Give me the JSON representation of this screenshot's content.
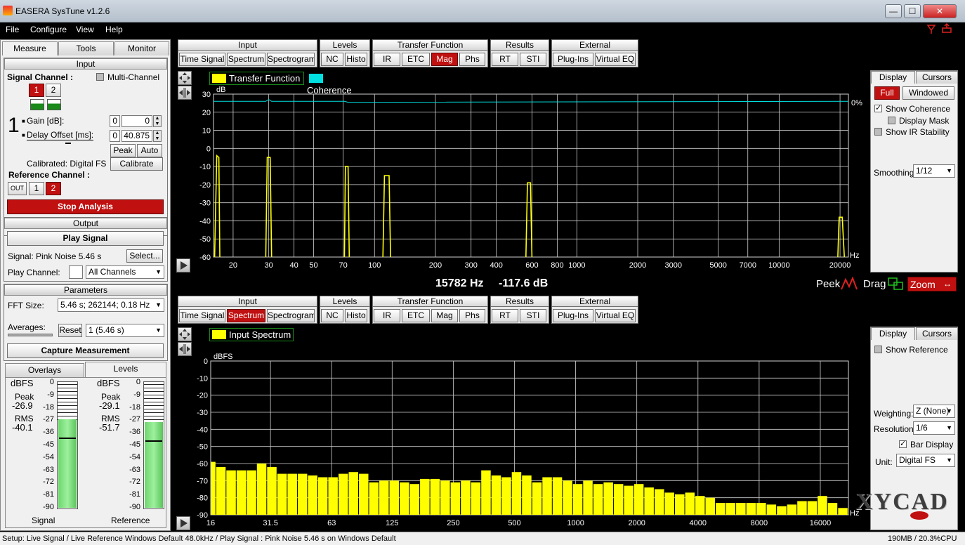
{
  "title_bar": {
    "title": "EASERA SysTune v1.2.6",
    "min": "—",
    "max": "☐",
    "close": "✕"
  },
  "menu": [
    "File",
    "Configure",
    "View",
    "Help"
  ],
  "left_tabs": [
    "Measure",
    "Tools",
    "Monitor"
  ],
  "input_section": {
    "header": "Input",
    "signal_channel": "Signal Channel :",
    "multi_channel": "Multi-Channel",
    "channel_buttons": [
      "1",
      "2"
    ],
    "channel_number": "1",
    "gain_label": "Gain [dB]:",
    "gain_box": "0",
    "gain_value": "0",
    "delay_label": "Delay Offset [ms]:",
    "delay_box": "0",
    "delay_value": "40.875",
    "peak": "Peak",
    "auto": "Auto",
    "calibrated": "Calibrated: Digital FS",
    "calibrate": "Calibrate",
    "reference_channel": "Reference Channel :",
    "ref_buttons": [
      "OUT",
      "1",
      "2"
    ]
  },
  "stop_analysis": "Stop Analysis",
  "output_section": {
    "header": "Output",
    "play_signal": "Play Signal",
    "signal": "Signal: Pink Noise  5.46 s",
    "select": "Select...",
    "play_channel": "Play Channel:",
    "play_channel_value": "All Channels"
  },
  "parameters_section": {
    "header": "Parameters",
    "fft_size": "FFT Size:",
    "fft_value": "5.46 s; 262144; 0.18 Hz",
    "averages": "Averages:",
    "reset": "Reset",
    "avg_value": "1 (5.46 s)",
    "capture": "Capture Measurement"
  },
  "bottom_tabs": [
    "Overlays",
    "Levels"
  ],
  "meters": {
    "unit": "dBFS",
    "scale": [
      "0",
      "-9",
      "-18",
      "-27",
      "-36",
      "-45",
      "-54",
      "-63",
      "-72",
      "-81",
      "-90"
    ],
    "signal": {
      "peak_label": "Peak",
      "peak": "-26.9",
      "rms_label": "RMS",
      "rms": "-40.1",
      "name": "Signal",
      "level_fraction": 0.7
    },
    "reference": {
      "peak_label": "Peak",
      "peak": "-29.1",
      "rms_label": "RMS",
      "rms": "-51.7",
      "name": "Reference",
      "level_fraction": 0.68
    }
  },
  "toolbar_top": {
    "groups": [
      {
        "name": "Input",
        "buttons": [
          "Time Signal",
          "Spectrum",
          "Spectrogram"
        ]
      },
      {
        "name": "Levels",
        "buttons": [
          "NC",
          "Histo"
        ]
      },
      {
        "name": "Transfer Function",
        "buttons": [
          "IR",
          "ETC",
          "Mag",
          "Phs"
        ]
      },
      {
        "name": "Results",
        "buttons": [
          "RT",
          "STI"
        ]
      },
      {
        "name": "External",
        "buttons": [
          "Plug-Ins",
          "Virtual EQ"
        ]
      }
    ],
    "active": "Mag"
  },
  "toolbar_bottom": {
    "active": "Spectrum"
  },
  "top_chart": {
    "legend": [
      "Transfer Function",
      "Coherence"
    ],
    "ylabel": "dB",
    "xunit": "Hz",
    "coherence_label": "0%",
    "readout_freq": "15782 Hz",
    "readout_db": "-117.6 dB",
    "peek": "Peek",
    "drag": "Drag",
    "zoom": "Zoom"
  },
  "top_right_panel": {
    "tabs": [
      "Display",
      "Cursors"
    ],
    "full": "Full",
    "windowed": "Windowed",
    "show_coherence": "Show Coherence",
    "display_mask": "Display Mask",
    "show_ir": "Show IR Stability",
    "smoothing_label": "Smoothing:",
    "smoothing": "1/12"
  },
  "bottom_chart": {
    "legend": "Input Spectrum",
    "ylabel": "dBFS",
    "xunit": "Hz"
  },
  "bottom_right_panel": {
    "tabs": [
      "Display",
      "Cursors"
    ],
    "show_reference": "Show Reference",
    "weighting_label": "Weighting:",
    "weighting": "Z (None)",
    "resolution_label": "Resolution:",
    "resolution": "1/6",
    "bar_display": "Bar Display",
    "unit_label": "Unit:",
    "unit": "Digital FS"
  },
  "watermark": "XYCAD",
  "status_bar": {
    "left": "Setup: Live Signal / Live Reference Windows Default 48.0kHz / Play Signal : Pink Noise  5.46 s on Windows Default",
    "right": "190MB / 20.3%CPU"
  },
  "colors": {
    "accent_red": "#c01010",
    "trace_yellow": "#ffff00",
    "coherence_cyan": "#00e0e0",
    "grid": "#d8d8d8"
  },
  "chart_data": [
    {
      "type": "line",
      "title": "",
      "ylabel": "dB",
      "xlabel": "Hz",
      "x_scale": "log",
      "xlim": [
        16,
        22000
      ],
      "ylim": [
        -60,
        30
      ],
      "yticks": [
        30,
        20,
        10,
        0,
        -10,
        -20,
        -30,
        -40,
        -50,
        -60
      ],
      "xticks": [
        20,
        30,
        40,
        50,
        70,
        100,
        200,
        300,
        400,
        600,
        800,
        1000,
        2000,
        3000,
        5000,
        7000,
        10000,
        20000
      ],
      "series": [
        {
          "name": "Transfer Function",
          "segments": [
            {
              "x": [
                16.2,
                16.6,
                17.0,
                17.2
              ],
              "y": [
                -60,
                -4,
                -5,
                -60
              ]
            },
            {
              "x": [
                29.0,
                29.5,
                30.5,
                31.0
              ],
              "y": [
                -60,
                -5,
                -5,
                -60
              ]
            },
            {
              "x": [
                71.0,
                71.8,
                74.0,
                75.0
              ],
              "y": [
                -60,
                -10,
                -10,
                -60
              ]
            },
            {
              "x": [
                110,
                112,
                118,
                120
              ],
              "y": [
                -60,
                -15,
                -15,
                -60
              ]
            },
            {
              "x": [
                560,
                570,
                590,
                600
              ],
              "y": [
                -60,
                -19,
                -19,
                -60
              ]
            },
            {
              "x": [
                19500,
                19800,
                20500,
                21000
              ],
              "y": [
                -60,
                -38,
                -38,
                -60
              ]
            }
          ]
        },
        {
          "name": "Coherence",
          "segments": [
            {
              "x": [
                16,
                29,
                30,
                31,
                71,
                74,
                22000
              ],
              "y": [
                26,
                26,
                27,
                26,
                26,
                25.5,
                26
              ]
            }
          ]
        }
      ]
    },
    {
      "type": "bar",
      "title": "",
      "ylabel": "dBFS",
      "xlabel": "Hz",
      "x_scale": "log",
      "xlim": [
        16,
        22000
      ],
      "ylim": [
        -90,
        0
      ],
      "yticks": [
        0,
        -10,
        -20,
        -30,
        -40,
        -50,
        -60,
        -70,
        -80,
        -90
      ],
      "xticks": [
        16,
        31.5,
        63,
        125,
        250,
        500,
        1000,
        2000,
        4000,
        8000,
        16000
      ],
      "bar_count": 63,
      "bar_start_hz": 16,
      "bar_step_octaves": 0.16667,
      "series": [
        {
          "name": "Input Spectrum",
          "values": [
            -59,
            -62,
            -64,
            -64,
            -64,
            -60,
            -62,
            -66,
            -66,
            -66,
            -67,
            -68,
            -68,
            -66,
            -65,
            -66,
            -71,
            -70,
            -70,
            -71,
            -72,
            -69,
            -69,
            -70,
            -71,
            -70,
            -71,
            -64,
            -67,
            -68,
            -65,
            -67,
            -71,
            -68,
            -68,
            -70,
            -72,
            -70,
            -72,
            -71,
            -72,
            -73,
            -72,
            -74,
            -75,
            -77,
            -78,
            -77,
            -79,
            -80,
            -83,
            -83,
            -83,
            -83,
            -83,
            -84,
            -85,
            -84,
            -82,
            -82,
            -79,
            -83,
            -86
          ]
        }
      ]
    }
  ]
}
